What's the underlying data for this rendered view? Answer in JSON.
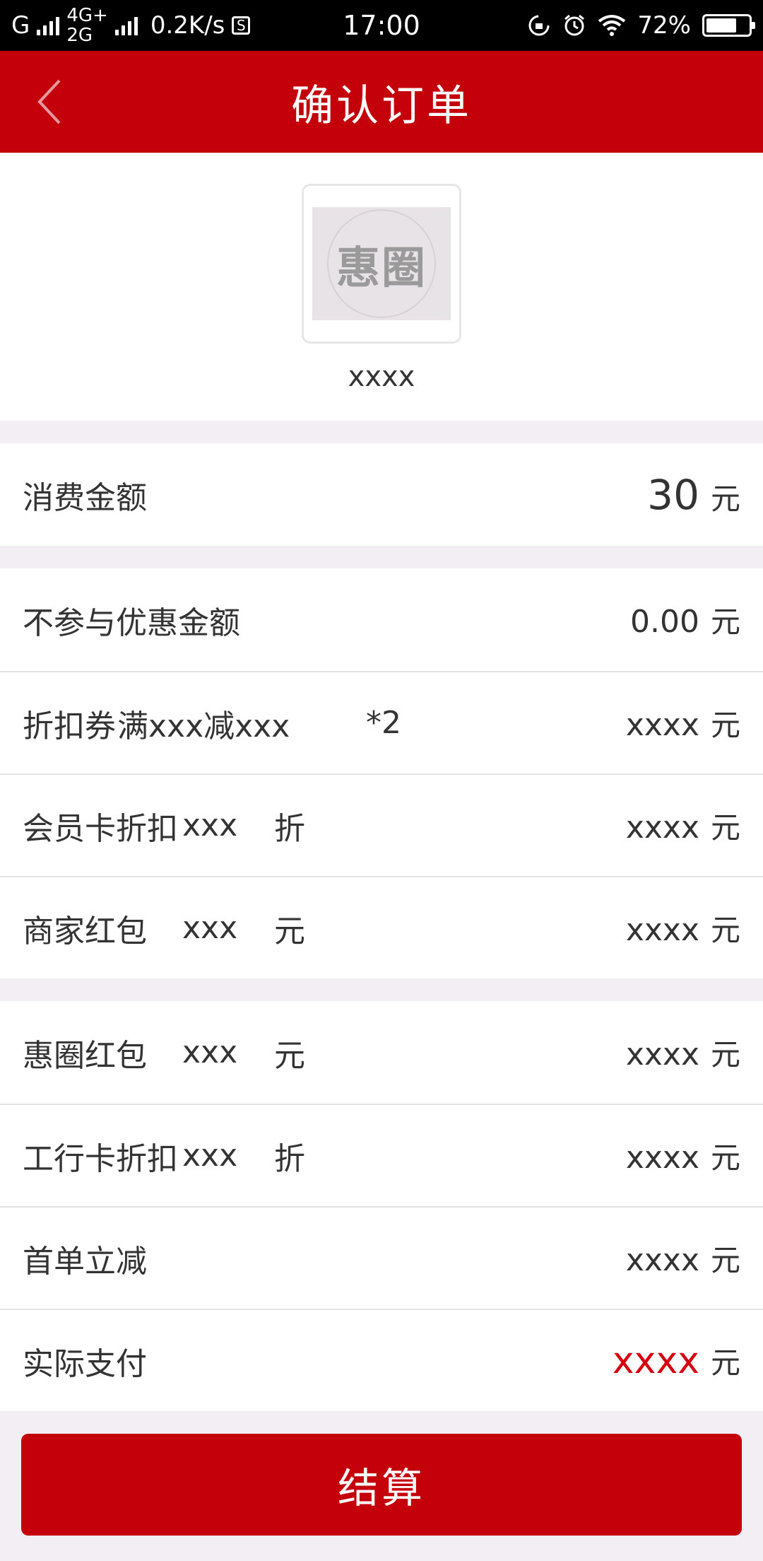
{
  "status_bar": {
    "carrier1": "G",
    "network1": "4G+",
    "network2": "2G",
    "speed": "0.2K/s",
    "s_icon": "S",
    "time": "17:00",
    "battery_percent": "72%",
    "battery_level": 0.72
  },
  "header": {
    "title": "确认订单",
    "back_icon": "chevron-left-icon"
  },
  "merchant": {
    "logo_text": "惠圈",
    "name": "xxxx"
  },
  "amount_row": {
    "label": "消费金额",
    "value": "30",
    "unit": "元"
  },
  "discount_rows": [
    {
      "label": "不参与优惠金额",
      "detail": "",
      "detail_suffix": "",
      "value": "0.00",
      "unit": "元"
    },
    {
      "label": "折扣券",
      "detail": "满xxx减xxx",
      "detail_suffix": "*2",
      "value": "xxxx",
      "unit": "元"
    },
    {
      "label": "会员卡折扣",
      "detail": "xxx",
      "detail_suffix": "折",
      "value": "xxxx",
      "unit": "元"
    },
    {
      "label": "商家红包",
      "detail": "xxx",
      "detail_suffix": "元",
      "value": "xxxx",
      "unit": "元"
    }
  ],
  "extra_rows": [
    {
      "label": "惠圈红包",
      "detail": "xxx",
      "detail_suffix": "元",
      "value": "xxxx",
      "unit": "元"
    },
    {
      "label": "工行卡折扣",
      "detail": "xxx",
      "detail_suffix": "折",
      "value": "xxxx",
      "unit": "元"
    },
    {
      "label": "首单立减",
      "value": "xxxx",
      "unit": "元"
    }
  ],
  "actual_pay": {
    "label": "实际支付",
    "value": "xxxx",
    "unit": "元",
    "accent_color": "#d7000f"
  },
  "checkout_button": {
    "label": "结算",
    "color": "#c4000b"
  }
}
